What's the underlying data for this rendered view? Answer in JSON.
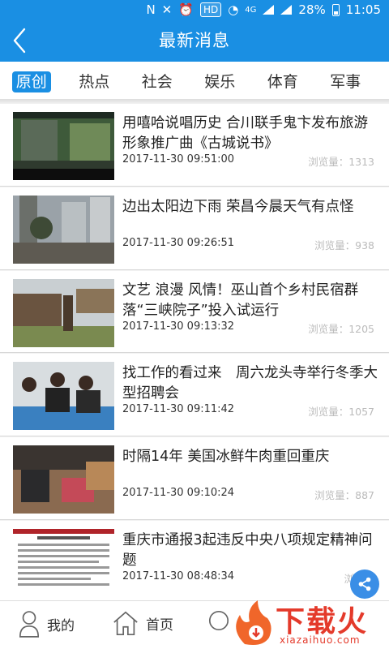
{
  "status_bar": {
    "battery": "28%",
    "time": "11:05",
    "hd": "HD",
    "network": "4G"
  },
  "header": {
    "title": "最新消息"
  },
  "tabs": [
    {
      "label": "原创",
      "active": true
    },
    {
      "label": "热点",
      "active": false
    },
    {
      "label": "社会",
      "active": false
    },
    {
      "label": "娱乐",
      "active": false
    },
    {
      "label": "体育",
      "active": false
    },
    {
      "label": "军事",
      "active": false
    }
  ],
  "news": [
    {
      "title": "用嘻哈说唱历史 合川联手鬼卞发布旅游形象推广曲《古城说书》",
      "time": "2017-11-30 09:51:00",
      "views": "浏览量：1313"
    },
    {
      "title": "边出太阳边下雨 荣昌今晨天气有点怪",
      "time": "2017-11-30 09:26:51",
      "views": "浏览量：938"
    },
    {
      "title": "文艺 浪漫 风情！巫山首个乡村民宿群落“三峡院子”投入试运行",
      "time": "2017-11-30 09:13:32",
      "views": "浏览量：1205"
    },
    {
      "title": "找工作的看过来　周六龙头寺举行冬季大型招聘会",
      "time": "2017-11-30 09:11:42",
      "views": "浏览量：1057"
    },
    {
      "title": "时隔14年 美国冰鲜牛肉重回重庆",
      "time": "2017-11-30 09:10:24",
      "views": "浏览量：887"
    },
    {
      "title": "重庆市通报3起违反中央八项规定精神问题",
      "time": "2017-11-30 08:48:34",
      "views": "浏览量"
    }
  ],
  "bottom_nav": {
    "mine_label": "我的",
    "home_label": "首页"
  },
  "watermark": {
    "text": "下载火",
    "sub": "xiazaihuo.com"
  },
  "colors": {
    "primary": "#1a8fe3",
    "watermark": "#e43a2b"
  }
}
